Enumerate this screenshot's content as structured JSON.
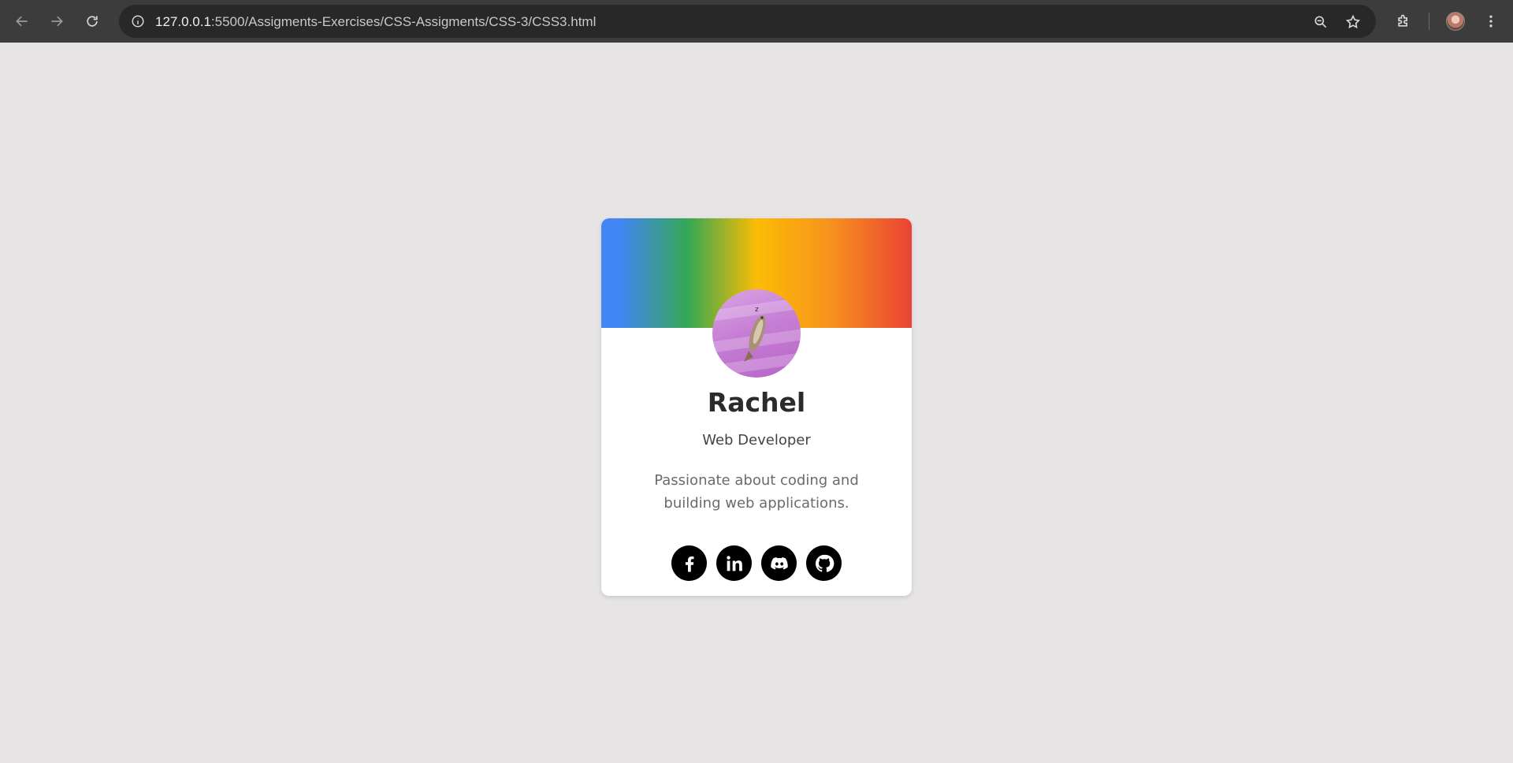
{
  "browser": {
    "url_host": "127.0.0.1",
    "url_rest": ":5500/Assigments-Exercises/CSS-Assigments/CSS-3/CSS3.html",
    "icons": [
      "back-icon",
      "forward-icon",
      "reload-icon",
      "info-icon",
      "zoom-icon",
      "star-icon",
      "extensions-icon",
      "profile-avatar",
      "menu-icon"
    ]
  },
  "card": {
    "banner_colors": [
      "#4285f4",
      "#34a853",
      "#fbbc05",
      "#f7941d",
      "#ea4335"
    ],
    "name": "Rachel",
    "role": "Web Developer",
    "bio": "Passionate about coding and building web applications.",
    "socials": [
      {
        "icon": "facebook-icon"
      },
      {
        "icon": "linkedin-icon"
      },
      {
        "icon": "discord-icon"
      },
      {
        "icon": "github-icon"
      }
    ]
  }
}
